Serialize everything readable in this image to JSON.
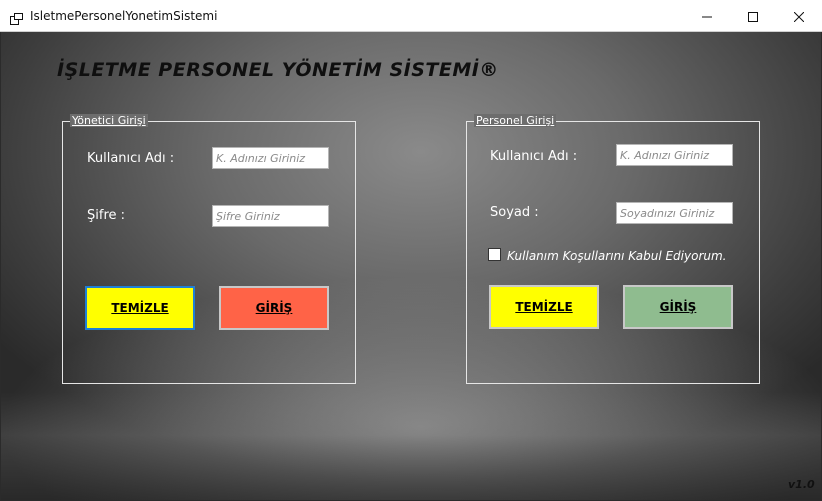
{
  "window": {
    "title": "IsletmePersonelYonetimSistemi",
    "icon": "app-window-icon",
    "controls": {
      "minimize": "minimize-icon",
      "maximize": "maximize-icon",
      "close": "close-icon"
    }
  },
  "main": {
    "title": "İŞLETME PERSONEL YÖNETİM SİSTEMİ®",
    "version": "v1.0"
  },
  "admin": {
    "legend": "Yönetici Girişi",
    "username_label": "Kullanıcı Adı :",
    "username_placeholder": "K. Adınızı Giriniz",
    "password_label": "Şifre :",
    "password_placeholder": "Şifre Giriniz",
    "clear_label": "TEMİZLE",
    "login_label": "GİRİŞ",
    "clear_color": "#ffff00",
    "login_color": "#ff6347"
  },
  "staff": {
    "legend": "Personel Girişi",
    "username_label": "Kullanıcı Adı :",
    "username_placeholder": "K. Adınızı Giriniz",
    "surname_label": "Soyad :",
    "surname_placeholder": "Soyadınızı Giriniz",
    "terms_label": "Kullanım Koşullarını Kabul Ediyorum.",
    "terms_checked": false,
    "clear_label": "TEMİZLE",
    "login_label": "GİRİŞ",
    "clear_color": "#ffff00",
    "login_color": "#8fbc8f"
  }
}
